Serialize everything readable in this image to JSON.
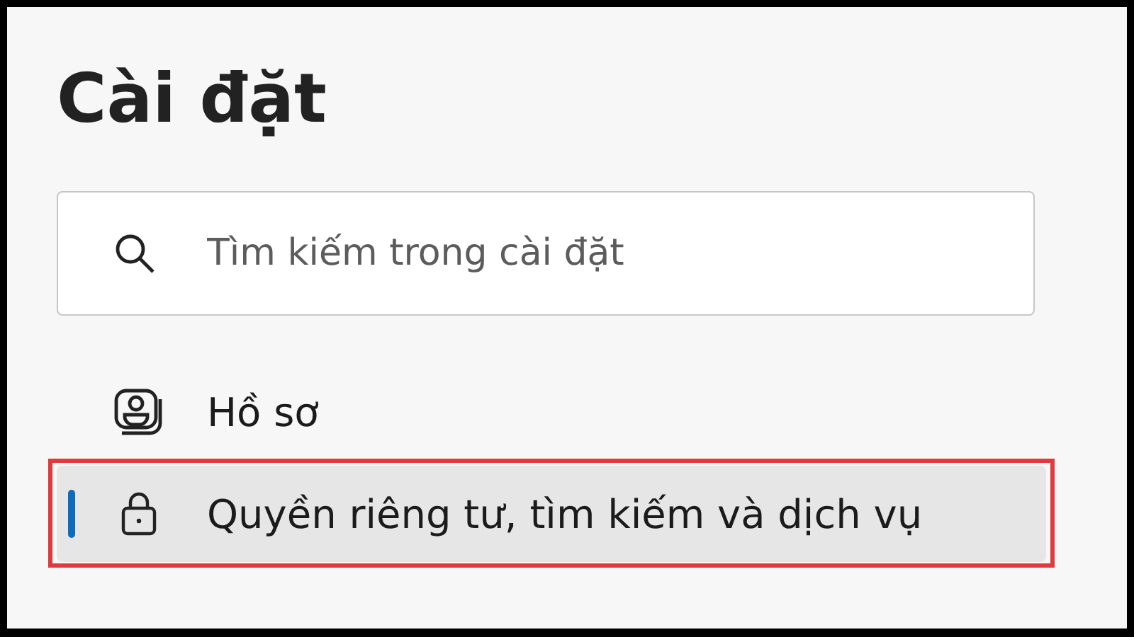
{
  "title": "Cài đặt",
  "search": {
    "placeholder": "Tìm kiếm trong cài đặt"
  },
  "nav_items": [
    {
      "label": "Hồ sơ",
      "kind": "profile",
      "selected": false,
      "highlighted": false
    },
    {
      "label": "Quyền riêng tư, tìm kiếm và dịch vụ",
      "kind": "lock",
      "selected": true,
      "highlighted": true
    }
  ]
}
